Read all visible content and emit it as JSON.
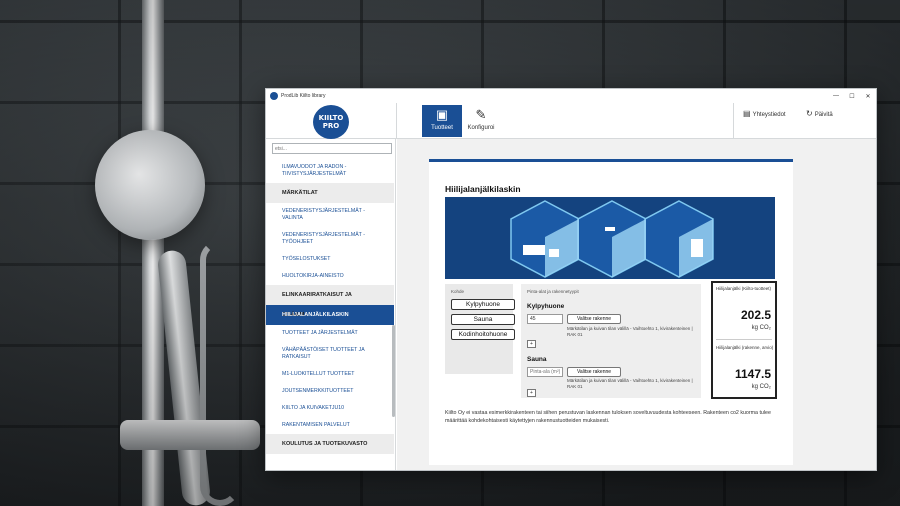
{
  "window": {
    "title": "ProdLib Kiilto library",
    "minimize": "—",
    "maximize": "☐",
    "close": "✕"
  },
  "logo": {
    "line1": "KIILTO",
    "line2": "PRO"
  },
  "topnav": {
    "products": "Tuotteet",
    "configure": "Konfiguroi",
    "contact": "Yhteystiedot",
    "refresh": "Päivitä"
  },
  "sidebar": {
    "search_placeholder": "etsi...",
    "items": [
      {
        "type": "item",
        "label": "ILMAVUODOT JA RADON -TIIVISTYSJÄRJESTELMÄT"
      },
      {
        "type": "header",
        "label": "MÄRKÄTILAT"
      },
      {
        "type": "item",
        "label": "VEDENERISTYSJÄRJESTELMÄT - VALINTA"
      },
      {
        "type": "item",
        "label": "VEDENERISTYSJÄRJESTELMÄT - TYÖOHJEET"
      },
      {
        "type": "item",
        "label": "TYÖSELOSTUKSET"
      },
      {
        "type": "item",
        "label": "HUOLTOKIRJA-AINEISTO"
      },
      {
        "type": "header",
        "label": "ELINKAARIRATKAISUT JA SISÄILMA"
      },
      {
        "type": "active",
        "label": "HIILIJALANJÄLKILASKIN"
      },
      {
        "type": "item",
        "label": "TUOTTEET JA JÄRJESTELMÄT"
      },
      {
        "type": "item",
        "label": "VÄHÄPÄÄSTÖISET TUOTTEET JA RATKAISUT"
      },
      {
        "type": "item",
        "label": "M1-LUOKITELLUT TUOTTEET"
      },
      {
        "type": "item",
        "label": "JOUTSENMERKKITUOTTEET"
      },
      {
        "type": "item",
        "label": "KIILTO JA KUIVAKETJU10"
      },
      {
        "type": "item",
        "label": "RAKENTAMISEN PALVELUT"
      },
      {
        "type": "header",
        "label": "KOULUTUS JA TUOTEKUVASTO"
      }
    ]
  },
  "calculator": {
    "title": "Hiilijalanjälkilaskin",
    "target_label": "Kohde",
    "rooms": [
      "Kylpyhuone",
      "Sauna",
      "Kodinhoitohuone"
    ],
    "area_label": "Pinta-alat ja rakennetyypit",
    "entries": [
      {
        "name": "Kylpyhuone",
        "area_value": "45",
        "area_placeholder": "",
        "select_label": "Valitse rakenne",
        "description": "Märkätilan ja kuivan tilan välillä - Vaihtoehto 1, kivirakenteinen | RAK 01",
        "add": "+"
      },
      {
        "name": "Sauna",
        "area_value": "",
        "area_placeholder": "Pinta-ala (m²)",
        "select_label": "Valitse rakenne",
        "description": "Märkätilan ja kuivan tilan välillä - Vaihtoehto 1, kivirakenteinen | RAK 01",
        "add": "+"
      }
    ],
    "results": [
      {
        "label": "Hiilijalanjälki (Kiilto-tuotteet)",
        "value": "202.5",
        "unit": "kg CO₂"
      },
      {
        "label": "Hiilijalanjälki (rakenne, arvio)",
        "value": "1147.5",
        "unit": "kg CO₂"
      }
    ],
    "disclaimer": "Kiilto Oy ei vastaa esimerkkirakenteen tai siihen perustuvan laskennan tuloksen soveltuvuudesta kohteeseen. Rakenteen co2 kuorma tulee määrittää kohdekohtaisesti käytettyjen rakennustuotteiden mukaisesti."
  },
  "colors": {
    "brand_blue": "#1a4f95",
    "banner_blue": "#14437f"
  },
  "icons": {
    "products": "box-icon",
    "configure": "edit-icon",
    "contact": "book-icon",
    "refresh": "refresh-icon"
  }
}
